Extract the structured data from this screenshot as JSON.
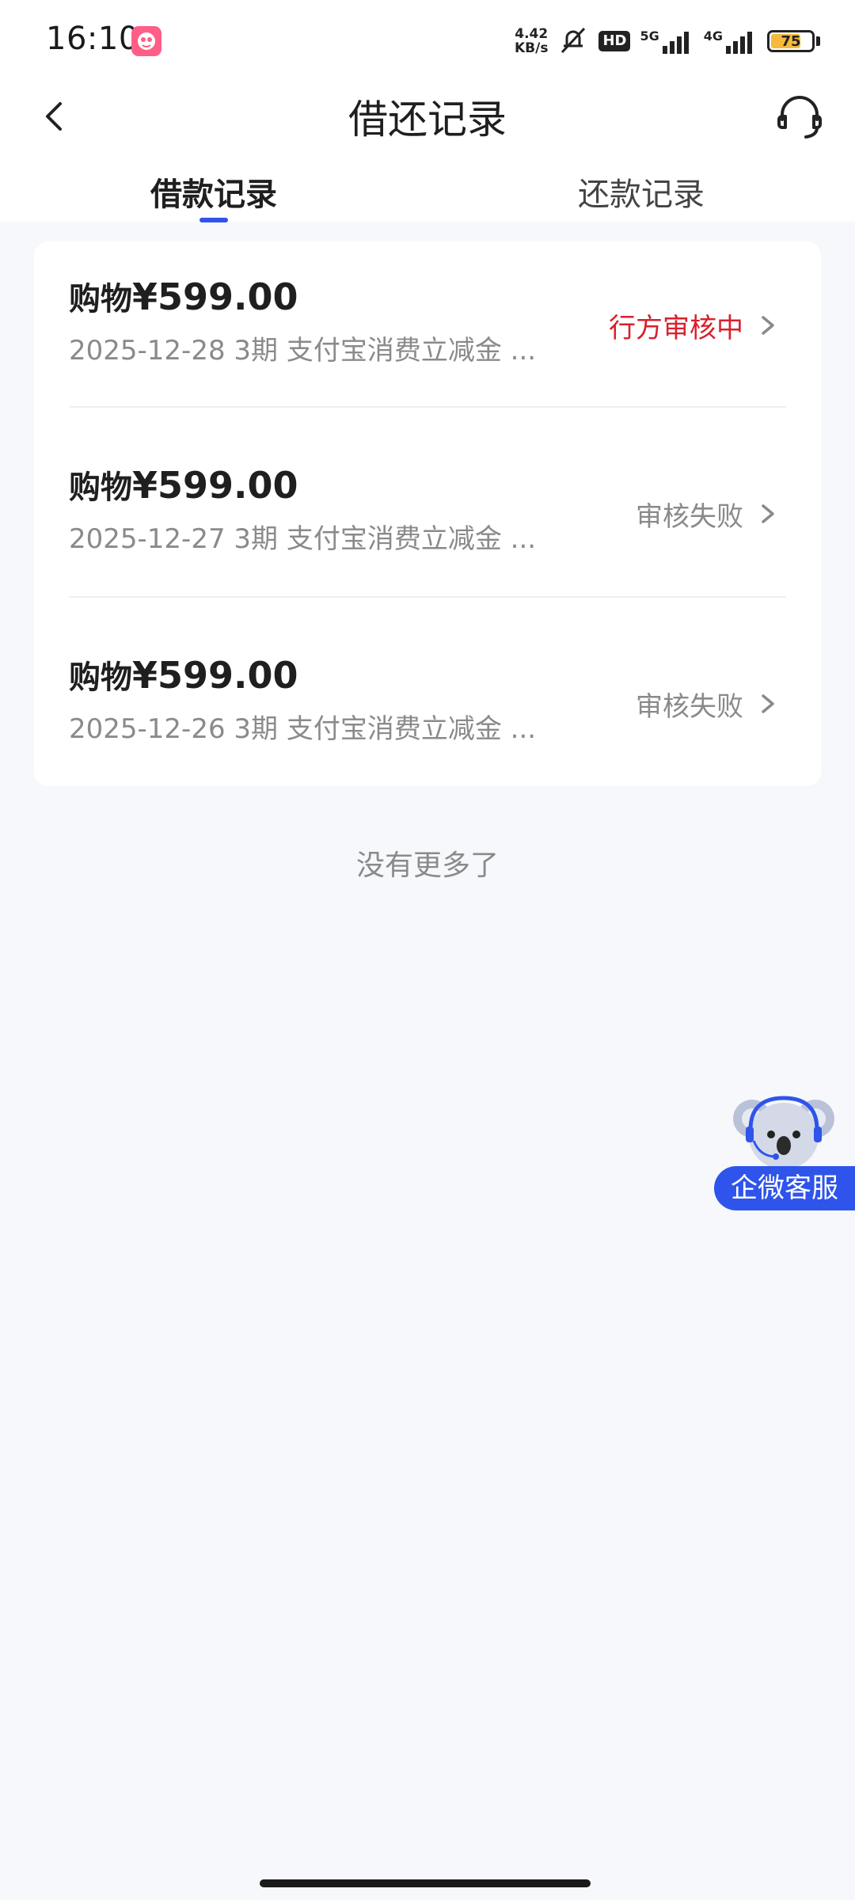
{
  "status_bar": {
    "time": "16:10",
    "net_speed_value": "4.42",
    "net_speed_unit": "KB/s",
    "hd_label": "HD",
    "sig1_label": "5G",
    "sig2_label": "4G",
    "battery_level": "75",
    "battery_color": "#f6b93b"
  },
  "header": {
    "title": "借还记录",
    "back_icon": "chevron-left-icon",
    "service_icon": "headset-icon"
  },
  "tabs": [
    {
      "label": "借款记录",
      "active": true
    },
    {
      "label": "还款记录",
      "active": false
    }
  ],
  "records": [
    {
      "title_prefix": "购物",
      "amount": "¥599.00",
      "subtitle": "2025-12-28 3期  支付宝消费立减金 ...",
      "status": "行方审核中"
    },
    {
      "title_prefix": "购物",
      "amount": "¥599.00",
      "subtitle": "2025-12-27 3期  支付宝消费立减金 ...",
      "status": "审核失败"
    },
    {
      "title_prefix": "购物",
      "amount": "¥599.00",
      "subtitle": "2025-12-26 3期  支付宝消费立减金 ...",
      "status": "审核失败"
    }
  ],
  "footer_text": "没有更多了",
  "float_service": {
    "label": "企微客服",
    "icon": "koala-mascot-icon"
  },
  "colors": {
    "accent": "#2f54eb",
    "pending": "#d9202d",
    "muted": "#8a8a8a",
    "background": "#f7f8fc"
  }
}
